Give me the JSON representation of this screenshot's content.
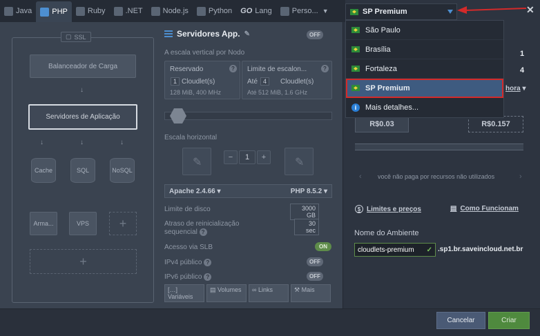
{
  "tabs": [
    {
      "label": "Java",
      "icon": "java-icon"
    },
    {
      "label": "PHP",
      "icon": "php-icon"
    },
    {
      "label": "Ruby",
      "icon": "ruby-icon"
    },
    {
      "label": ".NET",
      "icon": "dotnet-icon"
    },
    {
      "label": "Node.js",
      "icon": "nodejs-icon"
    },
    {
      "label": "Python",
      "icon": "python-icon"
    },
    {
      "label": "Lang",
      "icon": "go-icon",
      "prefix": "GO"
    },
    {
      "label": "Perso...",
      "icon": "custom-icon"
    }
  ],
  "topology": {
    "ssl_label": "SSL",
    "load_balancer": "Balanceador de Carga",
    "app_servers": "Servidores de Aplicação",
    "cache": "Cache",
    "sql": "SQL",
    "nosql": "NoSQL",
    "storage": "Arma...",
    "vps": "VPS"
  },
  "config": {
    "title": "Servidores App.",
    "toggle_off": "OFF",
    "vertical_label": "A escala vertical por Nodo",
    "reserved_label": "Reservado",
    "reserved_value": "1",
    "reserved_unit": "Cloudlet(s)",
    "reserved_info": "128 MiB, 400 MHz",
    "limit_label": "Limite de escalon...",
    "limit_prefix": "Até",
    "limit_value": "4",
    "limit_unit": "Cloudlet(s)",
    "limit_info": "Até 512 MiB, 1.6 GHz",
    "horizontal_label": "Escala horizontal",
    "node_count": "1",
    "minus": "−",
    "plus": "+",
    "server": "Apache 2.4.66",
    "php_version": "PHP 8.5.2",
    "disk_label": "Limite de disco",
    "disk_value": "3000 GB",
    "delay_label_1": "Atraso de reinicialização",
    "delay_label_2": "sequencial",
    "delay_value": "30 sec",
    "slb_label": "Acesso via SLB",
    "slb_toggle": "ON",
    "ipv4_label": "IPv4 público",
    "ipv4_toggle": "OFF",
    "ipv6_label": "IPv6 público",
    "ipv6_toggle": "OFF",
    "buttons": [
      "Variáveis",
      "Volumes",
      "Links",
      "Mais"
    ]
  },
  "region": {
    "selected": "SP Premium",
    "options": [
      "São Paulo",
      "Brasília",
      "Fortaleza",
      "SP Premium"
    ],
    "more": "Mais detalhes...",
    "flag_color": "#2e8b3a",
    "highlight_color": "#d42a2a"
  },
  "pricing": {
    "right_num_1": "1",
    "right_num_2": "4",
    "period": "hora",
    "min_price": "R$0.03",
    "max_price": "R$0.157",
    "note": "você não paga por recursos não utilizados",
    "limits_link": "Limites e preços",
    "how_link": "Como Funcionam"
  },
  "env": {
    "label": "Nome do Ambiente",
    "name": "cloudlets-premium",
    "domain": ".sp1.br.saveincloud.net.br"
  },
  "footer": {
    "cancel": "Cancelar",
    "create": "Criar"
  }
}
